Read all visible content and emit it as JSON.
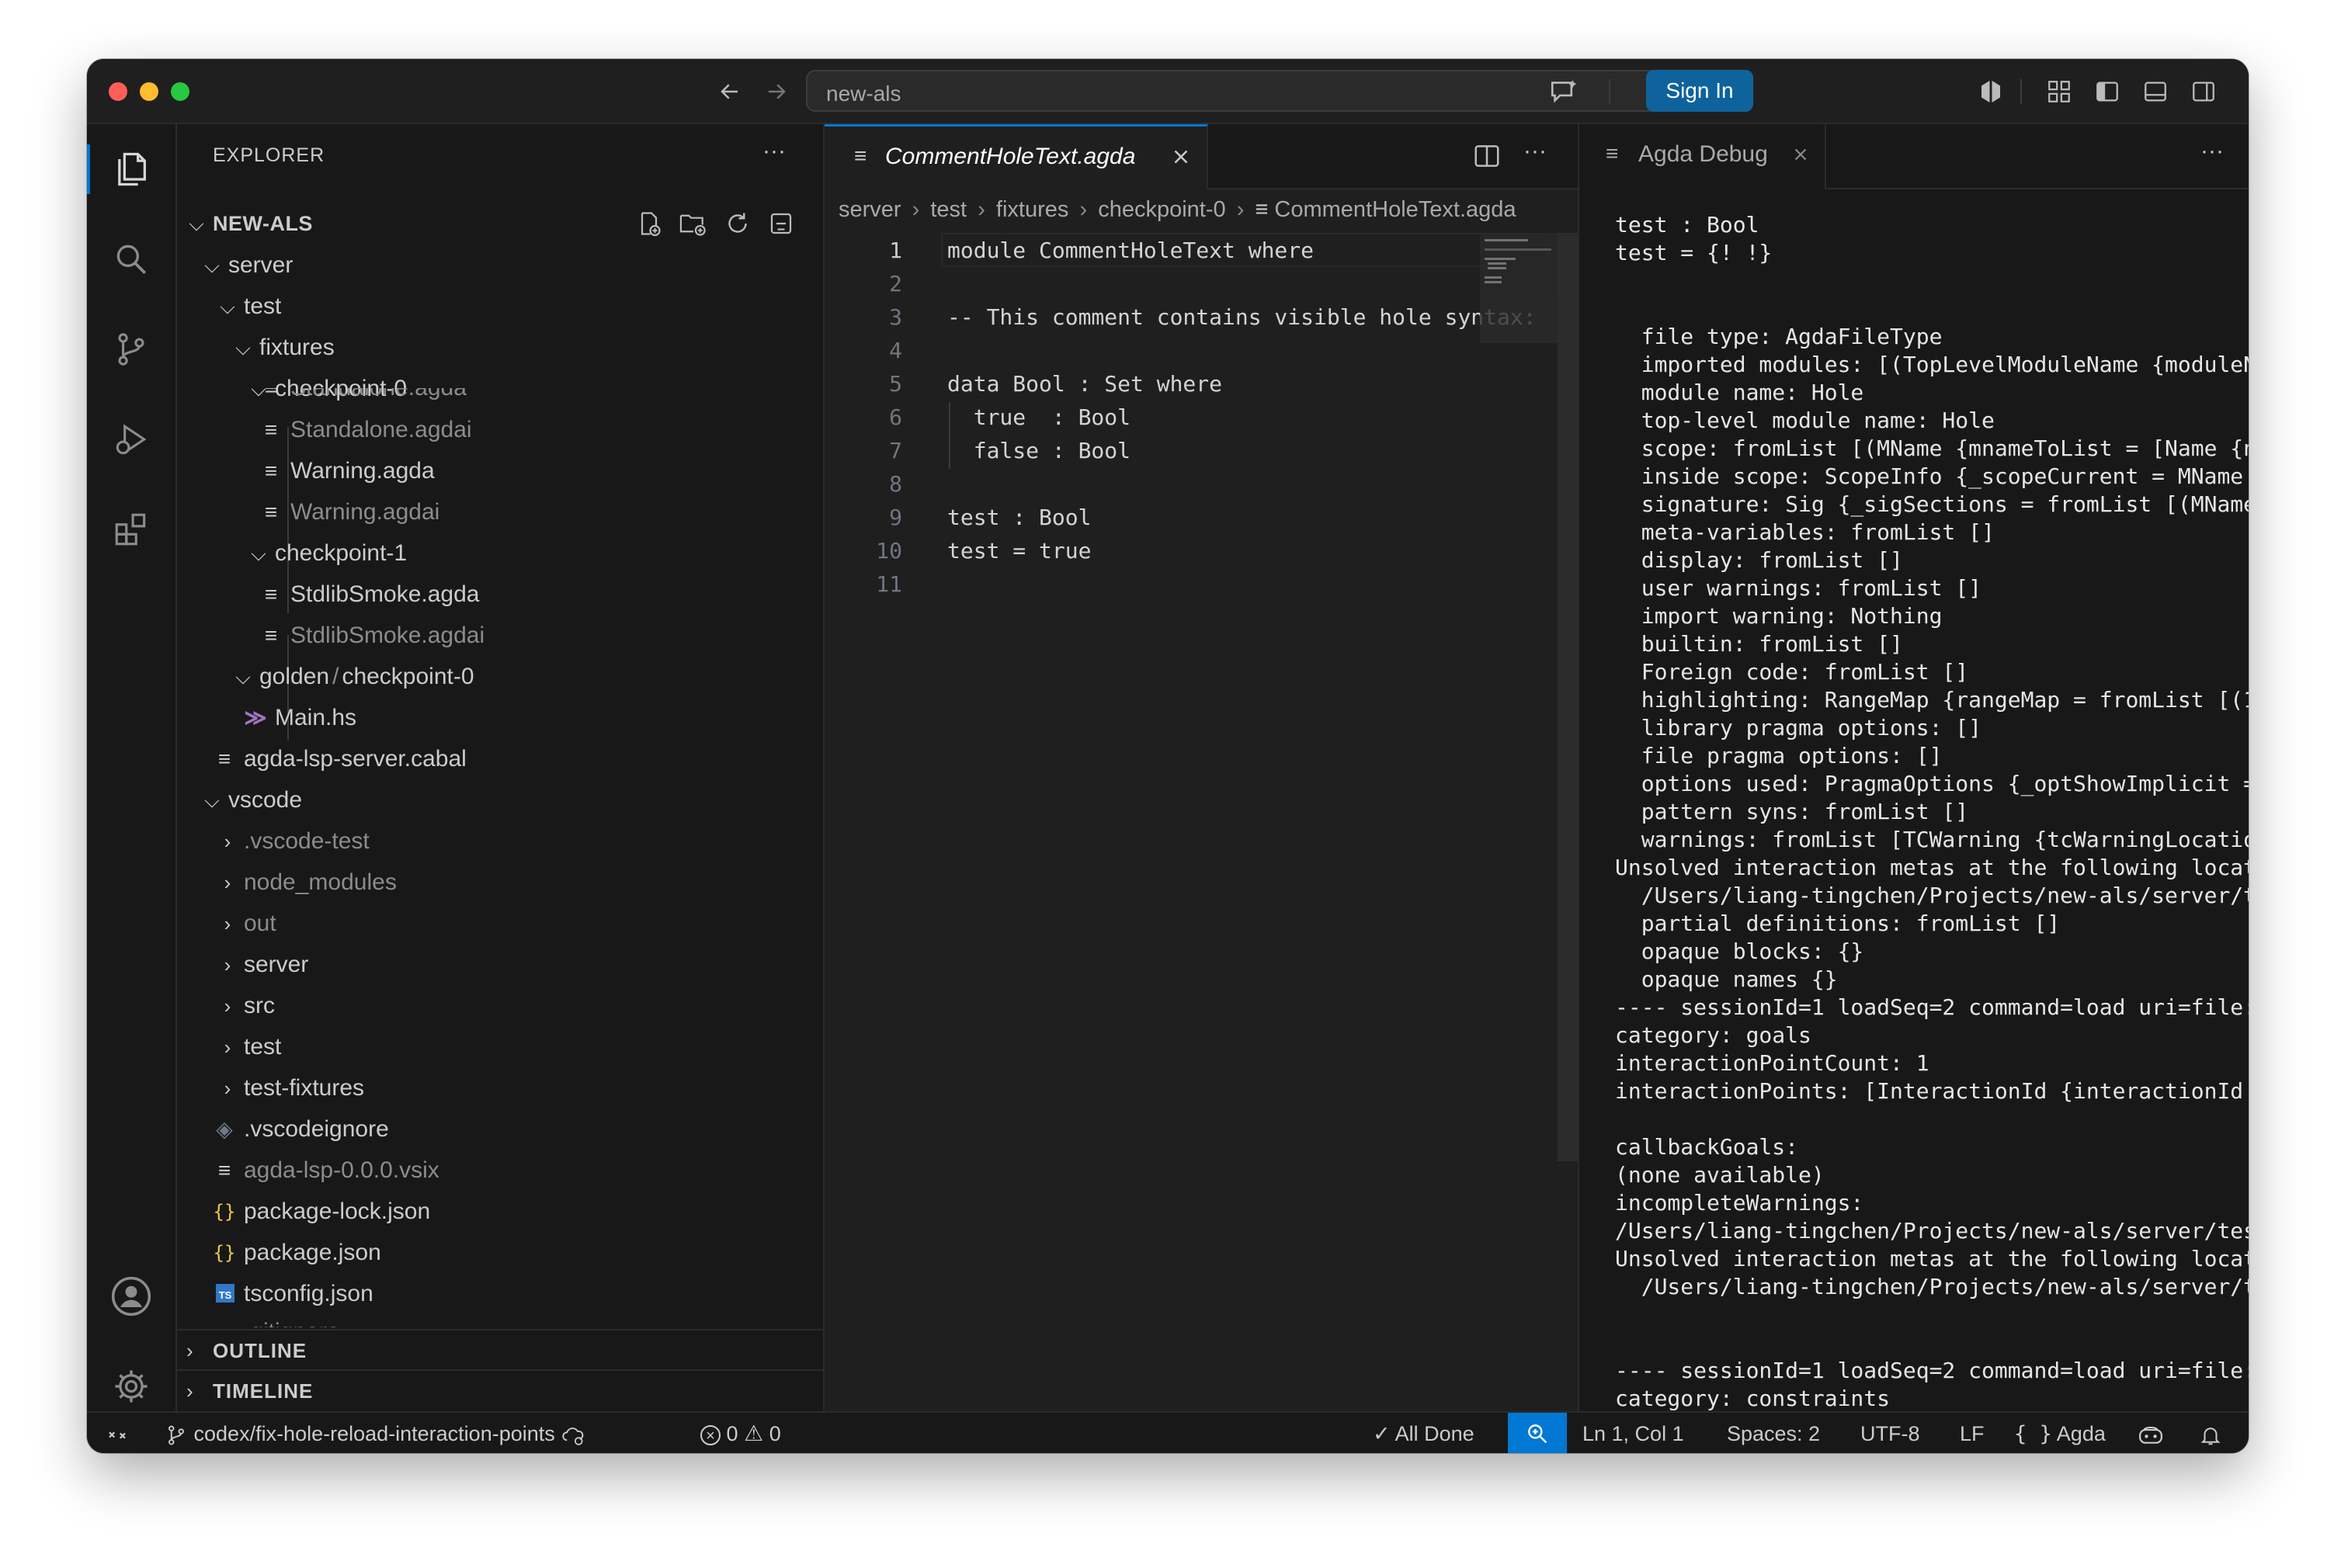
{
  "titlebar": {
    "command_center": "new-als",
    "sign_in_label": "Sign In"
  },
  "activity_bar": {
    "icons": [
      "explorer-icon",
      "search-icon",
      "source-control-icon",
      "run-debug-icon",
      "extensions-icon",
      "account-icon",
      "settings-gear-icon"
    ]
  },
  "explorer": {
    "title": "EXPLORER",
    "more": "···",
    "root": "NEW-ALS",
    "items": [
      {
        "label": "server"
      },
      {
        "label": "test"
      },
      {
        "label": "fixtures"
      },
      {
        "label": "checkpoint-0"
      },
      {
        "label": "Standalone.agda"
      },
      {
        "label": "Standalone.agdai"
      },
      {
        "label": "Warning.agda"
      },
      {
        "label": "Warning.agdai"
      },
      {
        "label": "checkpoint-1"
      },
      {
        "label": "StdlibSmoke.agda"
      },
      {
        "label": "StdlibSmoke.agdai"
      },
      {
        "label": "golden",
        "label2": "checkpoint-0",
        "sep": "/"
      },
      {
        "label": "Main.hs"
      },
      {
        "label": "agda-lsp-server.cabal"
      },
      {
        "label": "vscode"
      },
      {
        "label": ".vscode-test"
      },
      {
        "label": "node_modules"
      },
      {
        "label": "out"
      },
      {
        "label": "server"
      },
      {
        "label": "src"
      },
      {
        "label": "test"
      },
      {
        "label": "test-fixtures"
      },
      {
        "label": ".vscodeignore"
      },
      {
        "label": "agda-lsp-0.0.0.vsix"
      },
      {
        "label": "package-lock.json"
      },
      {
        "label": "package.json"
      },
      {
        "label": "tsconfig.json"
      },
      {
        "label": ".gitignore"
      }
    ],
    "outline_label": "OUTLINE",
    "timeline_label": "TIMELINE"
  },
  "editor": {
    "tab_label": "CommentHoleText.agda",
    "breadcrumbs": [
      "server",
      "test",
      "fixtures",
      "checkpoint-0",
      "CommentHoleText.agda"
    ],
    "lines": [
      "module CommentHoleText where",
      "",
      "-- This comment contains visible hole syntax:",
      "",
      "data Bool : Set where",
      "  true  : Bool",
      "  false : Bool",
      "",
      "test : Bool",
      "test = true",
      ""
    ],
    "line_numbers": [
      "1",
      "2",
      "3",
      "4",
      "5",
      "6",
      "7",
      "8",
      "9",
      "10",
      "11"
    ]
  },
  "debug_panel": {
    "tab_label": "Agda Debug",
    "more": "···",
    "text": "test : Bool\ntest = {! !}\n\n\n  file type: AgdaFileType\n  imported modules: [(TopLevelModuleName {moduleNa\n  module name: Hole\n  top-level module name: Hole\n  scope: fromList [(MName {mnameToList = [Name {na\n  inside scope: ScopeInfo {_scopeCurrent = MName {\n  signature: Sig {_sigSections = fromList [(MName\n  meta-variables: fromList []\n  display: fromList []\n  user warnings: fromList []\n  import warning: Nothing\n  builtin: fromList []\n  Foreign code: fromList []\n  highlighting: RangeMap {rangeMap = fromList [(1\n  library pragma options: []\n  file pragma options: []\n  options used: PragmaOptions {_optShowImplicit =\n  pattern syns: fromList []\n  warnings: fromList [TCWarning {tcWarningLocation\nUnsolved interaction metas at the following locat\n  /Users/liang-tingchen/Projects/new-als/server/te\n  partial definitions: fromList []\n  opaque blocks: {}\n  opaque names {}\n---- sessionId=1 loadSeq=2 command=load uri=file:/\ncategory: goals\ninteractionPointCount: 1\ninteractionPoints: [InteractionId {interactionId =\n\ncallbackGoals:\n(none available)\nincompleteWarnings:\n/Users/liang-tingchen/Projects/new-als/server/tes\nUnsolved interaction metas at the following locat\n  /Users/liang-tingchen/Projects/new-als/server/te\n\n\n---- sessionId=1 loadSeq=2 command=load uri=file:/\ncategory: constraints"
  },
  "status_bar": {
    "branch": "codex/fix-hole-reload-interaction-points",
    "errors": "0",
    "warnings": "0",
    "all_done": "All Done",
    "position": "Ln 1, Col 1",
    "spaces": "Spaces: 2",
    "encoding": "UTF-8",
    "eol": "LF",
    "language": "Agda"
  },
  "colors": {
    "accent": "#0078d4",
    "sign_in_bg": "#0e639c",
    "editor_bg": "#1f1f1f",
    "sidebar_bg": "#181818"
  }
}
